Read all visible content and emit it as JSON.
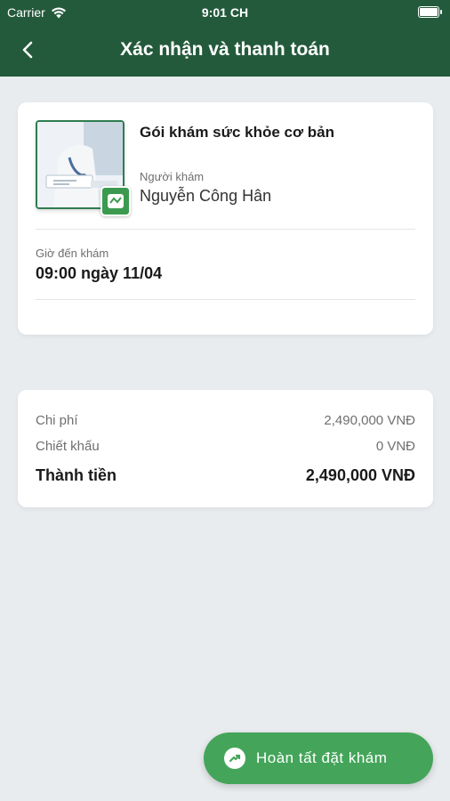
{
  "status_bar": {
    "carrier": "Carrier",
    "time": "9:01 CH"
  },
  "header": {
    "title": "Xác nhận và thanh toán"
  },
  "booking": {
    "package_name": "Gói khám sức khỏe cơ bản",
    "patient_label": "Người khám",
    "patient_name": "Nguyễn Công Hân",
    "time_label": "Giờ đến khám",
    "time_value": "09:00 ngày 11/04"
  },
  "payment": {
    "cost_label": "Chi phí",
    "cost_value": "2,490,000 VNĐ",
    "discount_label": "Chiết khấu",
    "discount_value": "0 VNĐ",
    "total_label": "Thành tiền",
    "total_value": "2,490,000 VNĐ"
  },
  "action": {
    "complete_label": "Hoàn tất đặt khám"
  },
  "colors": {
    "header": "#245a3c",
    "accent": "#44a55a",
    "background": "#e9ecef"
  }
}
